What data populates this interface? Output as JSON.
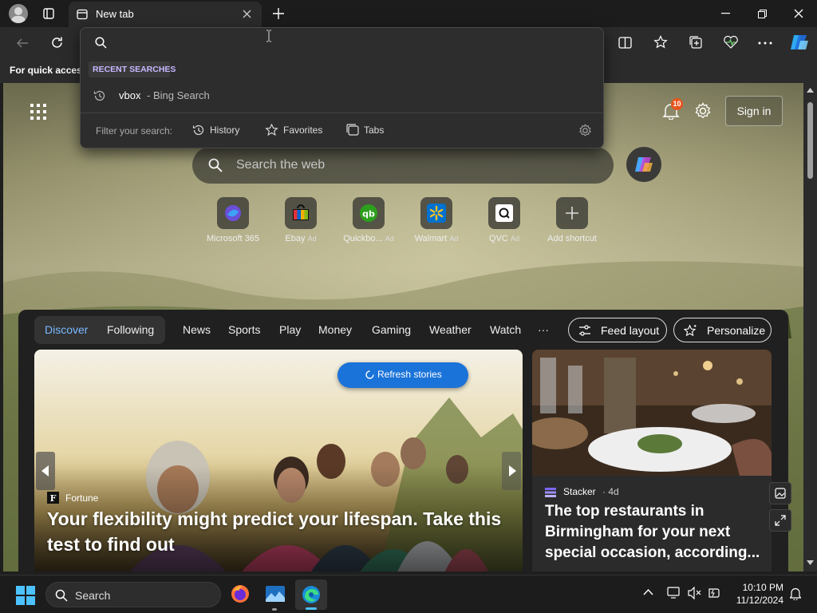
{
  "browser": {
    "tab_title": "New tab",
    "favorites_bar_text": "For quick access"
  },
  "dropdown": {
    "recent_header": "RECENT SEARCHES",
    "recent_item_query": "vbox",
    "recent_item_suffix": "- Bing Search",
    "filter_label": "Filter your search:",
    "filters": [
      "History",
      "Favorites",
      "Tabs"
    ]
  },
  "newtab": {
    "notification_count": "10",
    "sign_in_label": "Sign in",
    "search_placeholder": "Search the web",
    "quick_links": [
      {
        "label": "Microsoft 365",
        "ad": ""
      },
      {
        "label": "Ebay",
        "ad": "Ad"
      },
      {
        "label": "Quickbo...",
        "ad": "Ad"
      },
      {
        "label": "Walmart",
        "ad": "Ad"
      },
      {
        "label": "QVC",
        "ad": "Ad"
      },
      {
        "label": "Add shortcut",
        "ad": ""
      }
    ]
  },
  "feed": {
    "tabs": [
      "Discover",
      "Following"
    ],
    "nav": [
      "News",
      "Sports",
      "Play",
      "Money",
      "Gaming",
      "Weather",
      "Watch",
      "···"
    ],
    "feed_layout_label": "Feed layout",
    "personalize_label": "Personalize",
    "refresh_label": "Refresh stories",
    "main_story": {
      "source": "Fortune",
      "headline": "Your flexibility might predict your lifespan. Take this test to find out"
    },
    "side_story": {
      "source": "Stacker",
      "age": "· 4d",
      "headline": "The top restaurants in Birmingham for your next special occasion, according..."
    }
  },
  "taskbar": {
    "search_label": "Search",
    "time": "10:10 PM",
    "date": "11/12/2024"
  }
}
